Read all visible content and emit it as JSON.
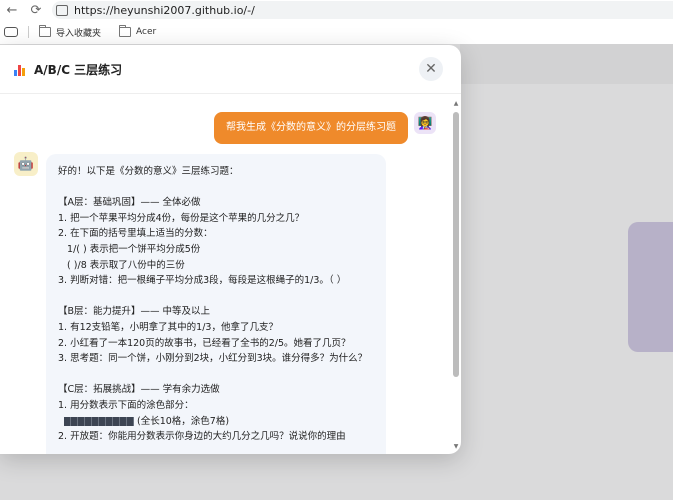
{
  "browser": {
    "url": "https://heyunshi2007.github.io/-/",
    "bookmarks": [
      {
        "label": "导入收藏夹"
      },
      {
        "label": "Acer"
      }
    ]
  },
  "modal": {
    "title": "A/B/C 三层练习",
    "close_symbol": "✕"
  },
  "chat": {
    "user_message": "帮我生成《分数的意义》的分层练习题",
    "bot_lines": [
      "好的！以下是《分数的意义》三层练习题：",
      "",
      "【A层：基础巩固】—— 全体必做",
      "1. 把一个苹果平均分成4份，每份是这个苹果的几分之几？",
      "2. 在下面的括号里填上适当的分数：",
      "   1/( ) 表示把一个饼平均分成5份",
      "   ( )/8 表示取了八份中的三份",
      "3. 判断对错：把一根绳子平均分成3段，每段是这根绳子的1/3。（ ）",
      "",
      "【B层：能力提升】—— 中等及以上",
      "1. 有12支铅笔，小明拿了其中的1/3，他拿了几支？",
      "2. 小红看了一本120页的故事书，已经看了全书的2/5。她看了几页？",
      "3. 思考题：同一个饼，小刚分到2块，小红分到3块。谁分得多？为什么？",
      "",
      "【C层：拓展挑战】—— 学有余力选做",
      "1. 用分数表示下面的涂色部分：",
      "(全长10格，涂色7格)",
      "2. 开放题：你能用分数表示你身边的大约几分之几吗？说说你的理由"
    ]
  },
  "colors": {
    "accent": "#ef8a2b",
    "bot_bubble": "#f3f6fb"
  }
}
